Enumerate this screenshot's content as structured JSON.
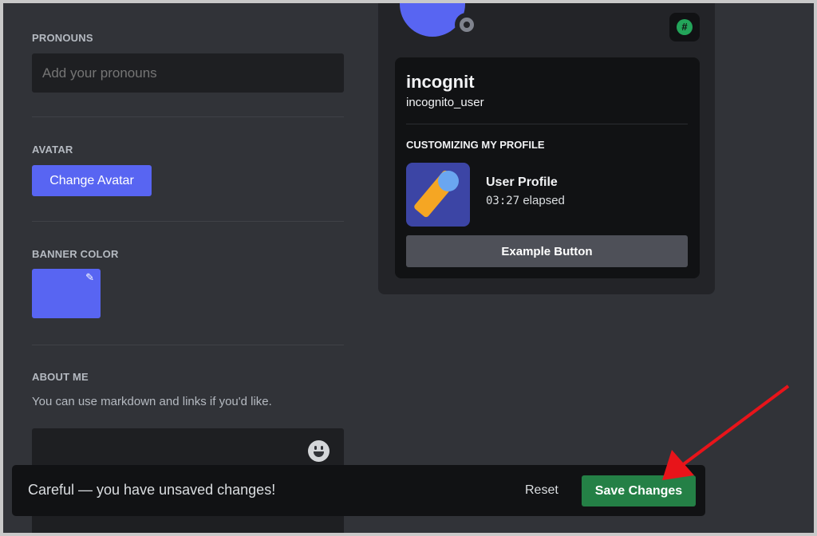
{
  "left": {
    "pronouns": {
      "label": "PRONOUNS",
      "placeholder": "Add your pronouns"
    },
    "avatar": {
      "label": "AVATAR",
      "button": "Change Avatar"
    },
    "banner": {
      "label": "BANNER COLOR",
      "color": "#5865f2",
      "edit_icon": "pencil-icon"
    },
    "about": {
      "label": "ABOUT ME",
      "hint": "You can use markdown and links if you'd like.",
      "emoji_icon": "smile-emoji-icon"
    }
  },
  "preview": {
    "display_name": "incognit",
    "username": "incognito_user",
    "activity_header": "CUSTOMIZING MY PROFILE",
    "activity_title": "User Profile",
    "activity_time": "03:27",
    "activity_elapsed": "elapsed",
    "example_button": "Example Button",
    "badge_icon": "hashtag-icon"
  },
  "notice": {
    "text": "Careful — you have unsaved changes!",
    "reset": "Reset",
    "save": "Save Changes"
  },
  "colors": {
    "accent": "#5865f2",
    "save": "#248046",
    "arrow": "#e8141a"
  }
}
